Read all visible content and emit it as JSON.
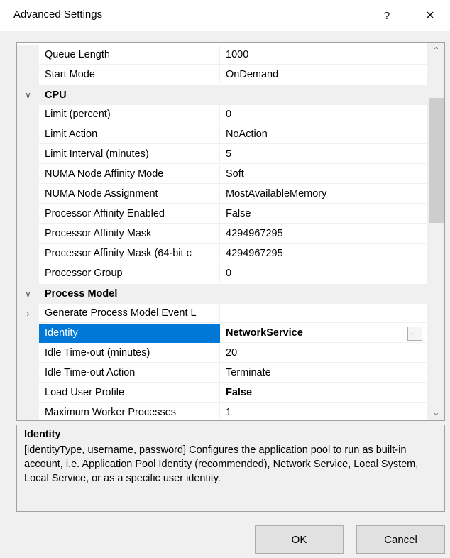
{
  "window": {
    "title": "Advanced Settings",
    "help_glyph": "?",
    "close_glyph": "✕"
  },
  "grid": {
    "rows": [
      {
        "kind": "prop",
        "name": "Queue Length",
        "value": "1000"
      },
      {
        "kind": "prop",
        "name": "Start Mode",
        "value": "OnDemand"
      },
      {
        "kind": "category",
        "name": "CPU",
        "expander": "∨"
      },
      {
        "kind": "prop",
        "name": "Limit (percent)",
        "value": "0"
      },
      {
        "kind": "prop",
        "name": "Limit Action",
        "value": "NoAction"
      },
      {
        "kind": "prop",
        "name": "Limit Interval (minutes)",
        "value": "5"
      },
      {
        "kind": "prop",
        "name": "NUMA Node Affinity Mode",
        "value": "Soft"
      },
      {
        "kind": "prop",
        "name": "NUMA Node Assignment",
        "value": "MostAvailableMemory"
      },
      {
        "kind": "prop",
        "name": "Processor Affinity Enabled",
        "value": "False"
      },
      {
        "kind": "prop",
        "name": "Processor Affinity Mask",
        "value": "4294967295"
      },
      {
        "kind": "prop",
        "name": "Processor Affinity Mask (64-bit c",
        "value": "4294967295"
      },
      {
        "kind": "prop",
        "name": "Processor Group",
        "value": "0"
      },
      {
        "kind": "category",
        "name": "Process Model",
        "expander": "∨"
      },
      {
        "kind": "prop",
        "name": "Generate Process Model Event L",
        "value": "",
        "expander": "›"
      },
      {
        "kind": "prop",
        "name": "Identity",
        "value": "NetworkService",
        "selected": true,
        "bold": true,
        "button": "..."
      },
      {
        "kind": "prop",
        "name": "Idle Time-out (minutes)",
        "value": "20"
      },
      {
        "kind": "prop",
        "name": "Idle Time-out Action",
        "value": "Terminate"
      },
      {
        "kind": "prop",
        "name": "Load User Profile",
        "value": "False",
        "bold": true
      },
      {
        "kind": "prop",
        "name": "Maximum Worker Processes",
        "value": "1"
      }
    ],
    "scroll_up_glyph": "⌃",
    "scroll_down_glyph": "⌄"
  },
  "description": {
    "title": "Identity",
    "text": "[identityType, username, password] Configures the application pool to run as built-in account, i.e. Application Pool Identity (recommended), Network Service, Local System, Local Service, or as a specific user identity."
  },
  "buttons": {
    "ok": "OK",
    "cancel": "Cancel"
  },
  "colors": {
    "selection": "#0078d7",
    "gutter": "#f0f0f0"
  }
}
